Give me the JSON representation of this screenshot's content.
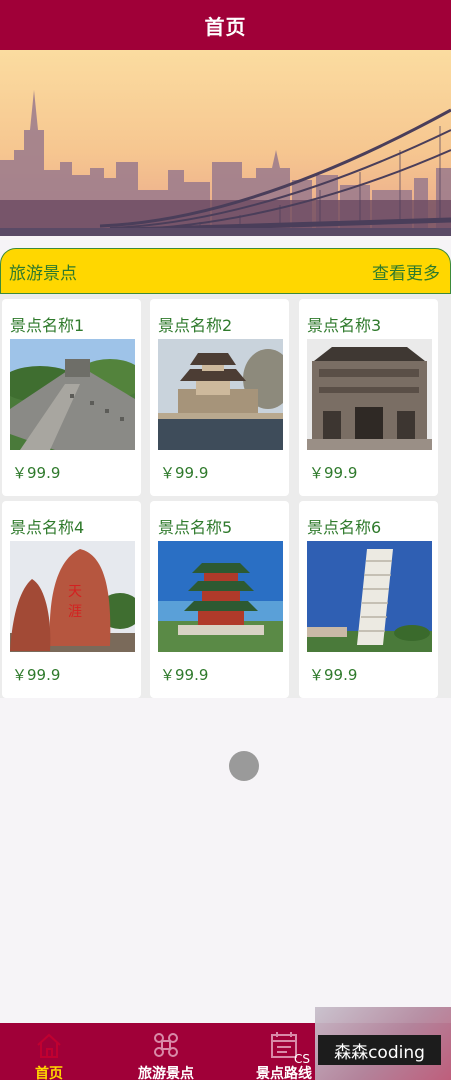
{
  "header": {
    "title": "首页"
  },
  "section": {
    "title": "旅游景点",
    "more": "查看更多"
  },
  "cards": [
    {
      "name": "景点名称1",
      "price": "￥99.9",
      "image": "great-wall"
    },
    {
      "name": "景点名称2",
      "price": "￥99.9",
      "image": "pavilion-lake"
    },
    {
      "name": "景点名称3",
      "price": "￥99.9",
      "image": "stone-archway"
    },
    {
      "name": "景点名称4",
      "price": "￥99.9",
      "image": "red-rock"
    },
    {
      "name": "景点名称5",
      "price": "￥99.9",
      "image": "tower-by-sea"
    },
    {
      "name": "景点名称6",
      "price": "￥99.9",
      "image": "leaning-tower"
    }
  ],
  "tabs": [
    {
      "label": "首页",
      "icon": "home-icon",
      "active": true
    },
    {
      "label": "旅游景点",
      "icon": "command-icon",
      "active": false
    },
    {
      "label": "景点路线",
      "icon": "calendar-icon",
      "active": false
    }
  ],
  "watermark": {
    "text": "森森coding",
    "cs": "CS"
  },
  "colors": {
    "header": "#a00038",
    "section_bar": "#ffd700",
    "text_green": "#2f7a2c",
    "tab_active": "#ffd700"
  }
}
